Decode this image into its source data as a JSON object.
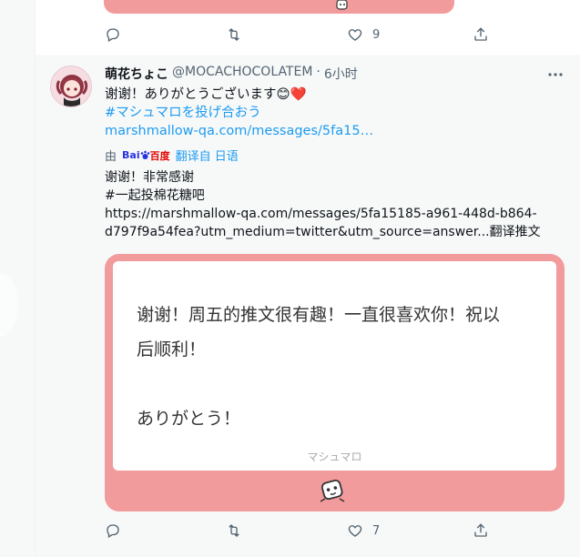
{
  "prev_tweet": {
    "actions": {
      "reply_count": "",
      "retweet_count": "",
      "like_count": "9",
      "share_count": ""
    }
  },
  "tweet": {
    "author_name": "萌花ちょこ",
    "handle": "@MOCACHOCOLATEM",
    "dot": "·",
    "time": "6小时",
    "text_line1": "谢谢！ありがとうございます😊❤️",
    "hashtag": "#マシュマロを投げ合おう",
    "link": "marshmallow-qa.com/messages/5fa15…",
    "translate_by": "由",
    "baidu_left": "Bai",
    "baidu_right": "百度",
    "translate_from": "翻译自 日语",
    "translated_lines": [
      "谢谢！非常感谢",
      "#一起投棉花糖吧",
      "https://marshmallow-qa.com/messages/5fa15185-a961-448d-b864-",
      "d797f9a54fea?utm_medium=twitter&utm_source=answer...翻译推文"
    ],
    "card": {
      "text_lines": [
        "谢谢！周五的推文很有趣！一直很喜欢你！祝以",
        "后顺利！",
        "",
        "ありがとう！"
      ],
      "footer": "マシュマロ",
      "accent_color": "#f29b9c"
    },
    "actions": {
      "reply_count": "",
      "retweet_count": "",
      "like_count": "7",
      "share_count": ""
    }
  },
  "icons": [
    "reply-icon",
    "retweet-icon",
    "like-icon",
    "share-icon",
    "more-icon",
    "marshmallow-icon",
    "baidu-logo"
  ]
}
